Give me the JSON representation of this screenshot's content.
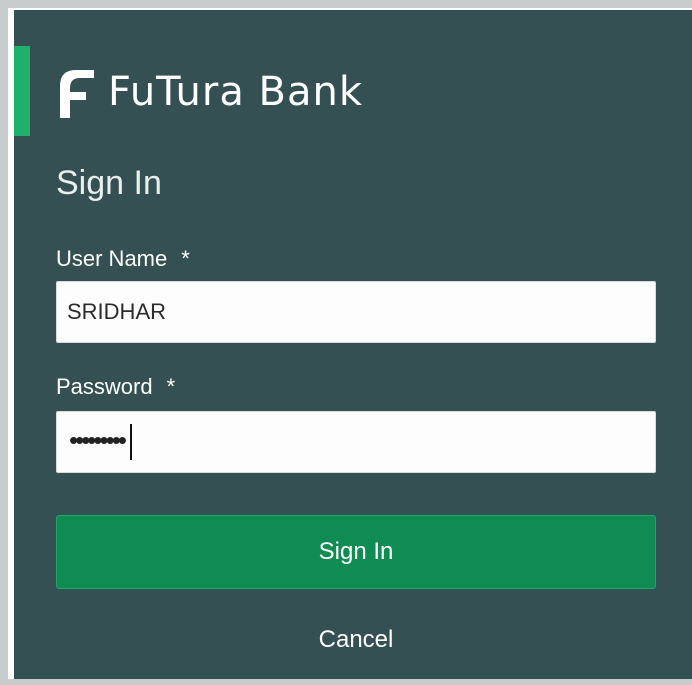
{
  "brand": {
    "name": "FuTura Bank",
    "logo_icon": "futura-f-logo-icon",
    "accent_color": "#1fb16b",
    "panel_color": "#355052"
  },
  "form": {
    "title": "Sign In",
    "username": {
      "label": "User Name",
      "required_marker": "*",
      "value": "SRIDHAR"
    },
    "password": {
      "label": "Password",
      "required_marker": "*",
      "masked_value": "•••••••••"
    },
    "sign_in_label": "Sign In",
    "cancel_label": "Cancel",
    "button_color": "#0f8c52"
  }
}
